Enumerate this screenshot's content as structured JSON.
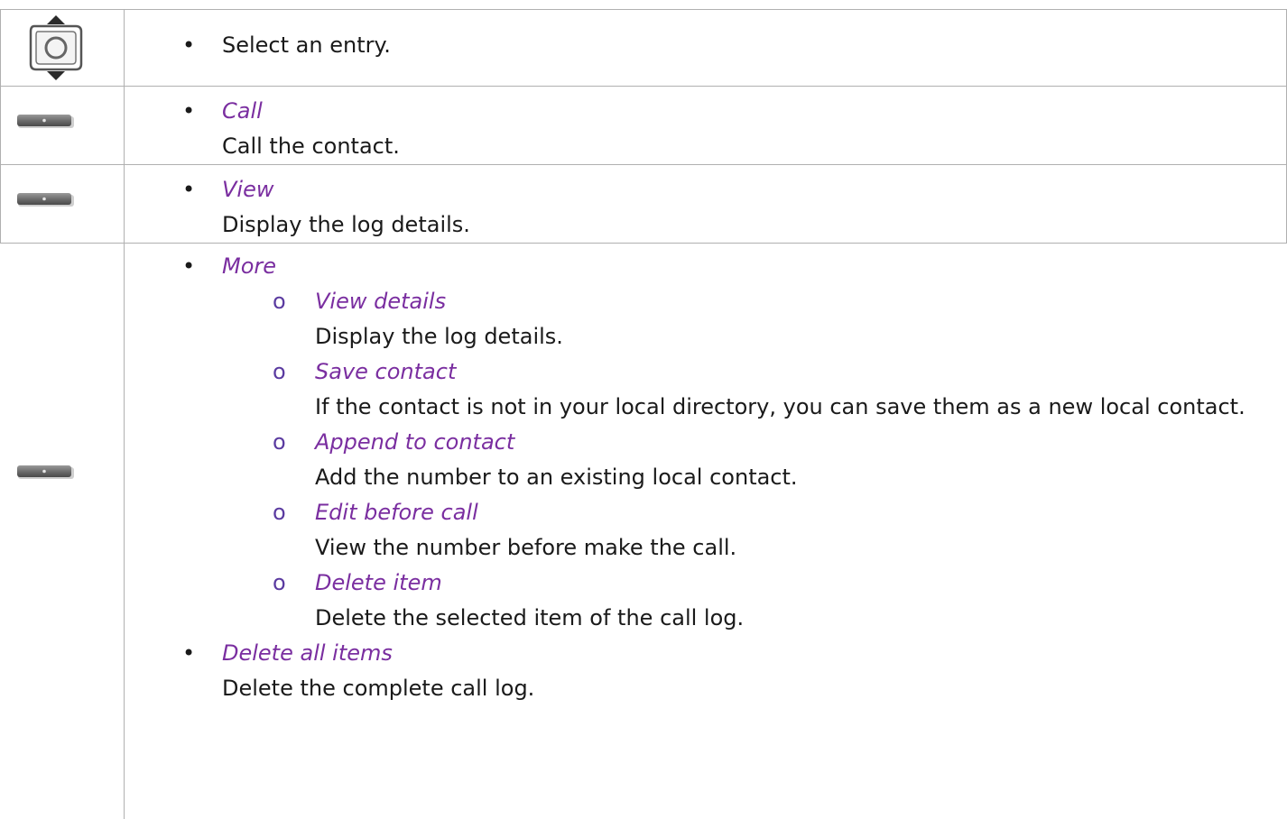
{
  "rows": [
    {
      "icon": "navigator-icon",
      "text": "Select an entry."
    },
    {
      "icon": "softkey-icon",
      "option": "Call",
      "description": "Call the contact."
    },
    {
      "icon": "softkey-icon",
      "option": "View",
      "description": "Display the log details."
    },
    {
      "icon": "softkey-icon",
      "option": "More",
      "subitems": [
        {
          "option": "View details",
          "description": "Display the log details."
        },
        {
          "option": "Save contact",
          "description": "If the contact is not in your local directory, you can save them as a new local contact."
        },
        {
          "option": "Append to contact",
          "description": "Add the number to an existing local contact."
        },
        {
          "option": "Edit before call",
          "description": "View the number before make the call."
        },
        {
          "option": "Delete item",
          "description": "Delete the selected item of the call log."
        }
      ],
      "extra_option": "Delete all items",
      "extra_description": "Delete the complete call log."
    }
  ],
  "bullet_symbol": "•",
  "sub_bullet_symbol": "o",
  "colors": {
    "option_text": "#7a2ea0",
    "body_text": "#1a1a1a",
    "border": "#b0b0b0"
  }
}
